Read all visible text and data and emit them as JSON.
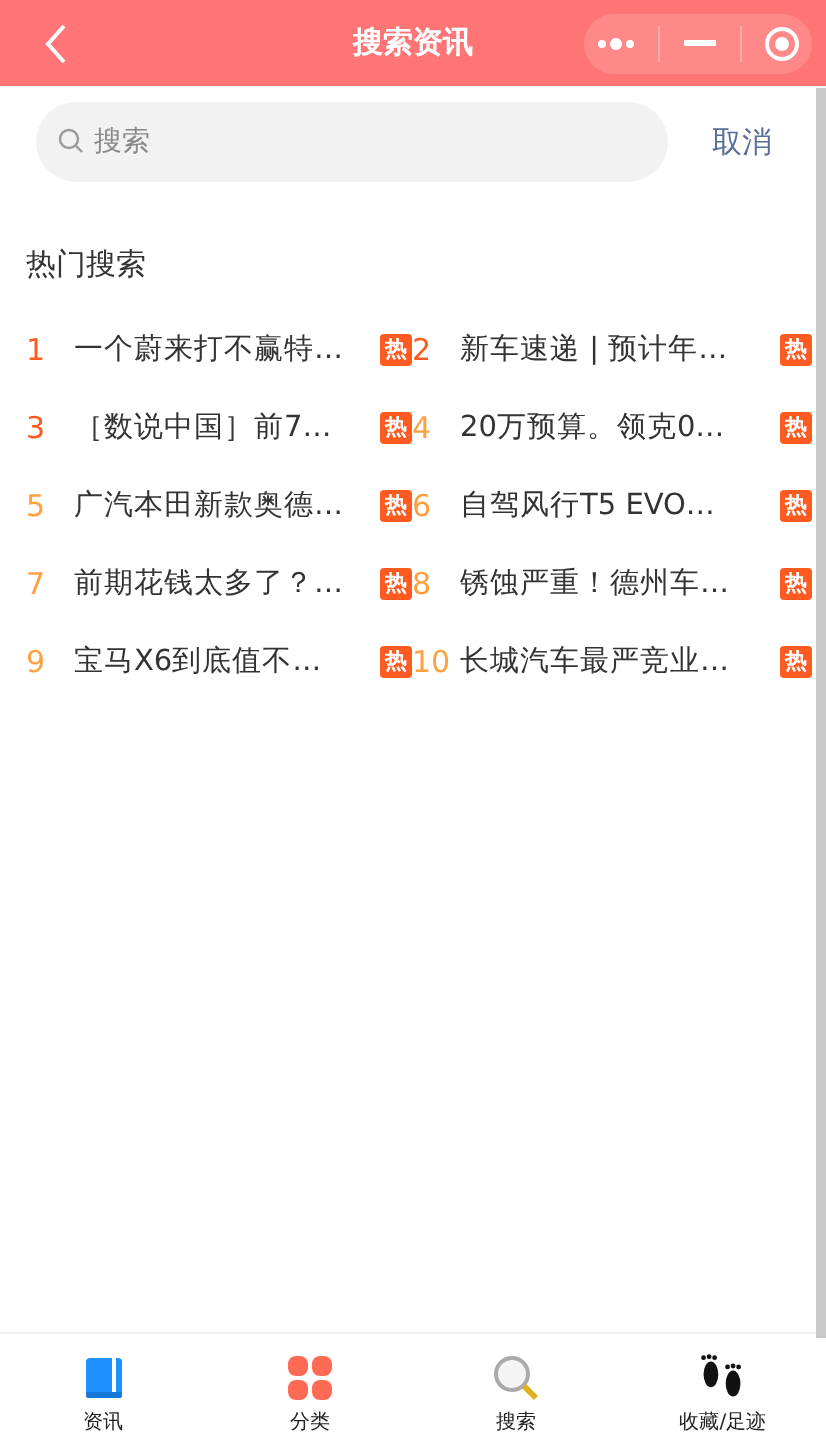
{
  "header": {
    "title": "搜索资讯"
  },
  "search": {
    "placeholder": "搜索",
    "cancel": "取消"
  },
  "hot": {
    "title": "热门搜索",
    "items": [
      {
        "rank": "1",
        "color": "#ff5a1f",
        "text": "一个蔚来打不赢特…",
        "badge": "热"
      },
      {
        "rank": "2",
        "color": "#ff5a1f",
        "text": "新车速递 | 预计年…",
        "badge": "热"
      },
      {
        "rank": "3",
        "color": "#ff5a1f",
        "text": "［数说中国］前7…",
        "badge": "热"
      },
      {
        "rank": "4",
        "color": "#ffa040",
        "text": "20万预算。领克0…",
        "badge": "热"
      },
      {
        "rank": "5",
        "color": "#ffa040",
        "text": "广汽本田新款奥德…",
        "badge": "热"
      },
      {
        "rank": "6",
        "color": "#ffa040",
        "text": "自驾风行T5 EVO…",
        "badge": "热"
      },
      {
        "rank": "7",
        "color": "#ffa040",
        "text": "前期花钱太多了？…",
        "badge": "热"
      },
      {
        "rank": "8",
        "color": "#ffa040",
        "text": "锈蚀严重！德州车…",
        "badge": "热"
      },
      {
        "rank": "9",
        "color": "#ffa040",
        "text": "宝马X6到底值不…",
        "badge": "热"
      },
      {
        "rank": "10",
        "color": "#ffa040",
        "text": "长城汽车最严竞业…",
        "badge": "热"
      }
    ]
  },
  "tabbar": [
    {
      "kind": "book",
      "label": "资讯",
      "selected": false
    },
    {
      "kind": "grid",
      "label": "分类",
      "selected": false
    },
    {
      "kind": "magnifier",
      "label": "搜索",
      "selected": false
    },
    {
      "kind": "feet",
      "label": "收藏/足迹",
      "selected": false
    }
  ]
}
